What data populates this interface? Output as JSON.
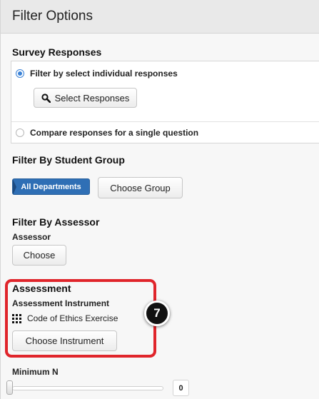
{
  "header": {
    "title": "Filter Options"
  },
  "survey_responses": {
    "title": "Survey Responses",
    "options": [
      {
        "label": "Filter by select individual responses",
        "selected": true
      },
      {
        "label": "Compare responses for a single question",
        "selected": false
      }
    ],
    "select_button": {
      "label": "Select Responses",
      "icon": "search-icon"
    }
  },
  "student_group": {
    "title": "Filter By Student Group",
    "tag": "All Departments",
    "choose_button": "Choose Group"
  },
  "assessor": {
    "title": "Filter By Assessor",
    "label": "Assessor",
    "choose_button": "Choose"
  },
  "assessment": {
    "title": "Assessment",
    "instrument_label": "Assessment Instrument",
    "instrument_name": "Code of Ethics Exercise",
    "instrument_icon": "grid-icon",
    "choose_button": "Choose Instrument"
  },
  "annotation": {
    "step": "7",
    "highlight_color": "#e0252b"
  },
  "minimum_n": {
    "label": "Minimum N",
    "value": "0"
  },
  "colors": {
    "accent": "#2f6fb5",
    "radio": "#3b82d6"
  }
}
